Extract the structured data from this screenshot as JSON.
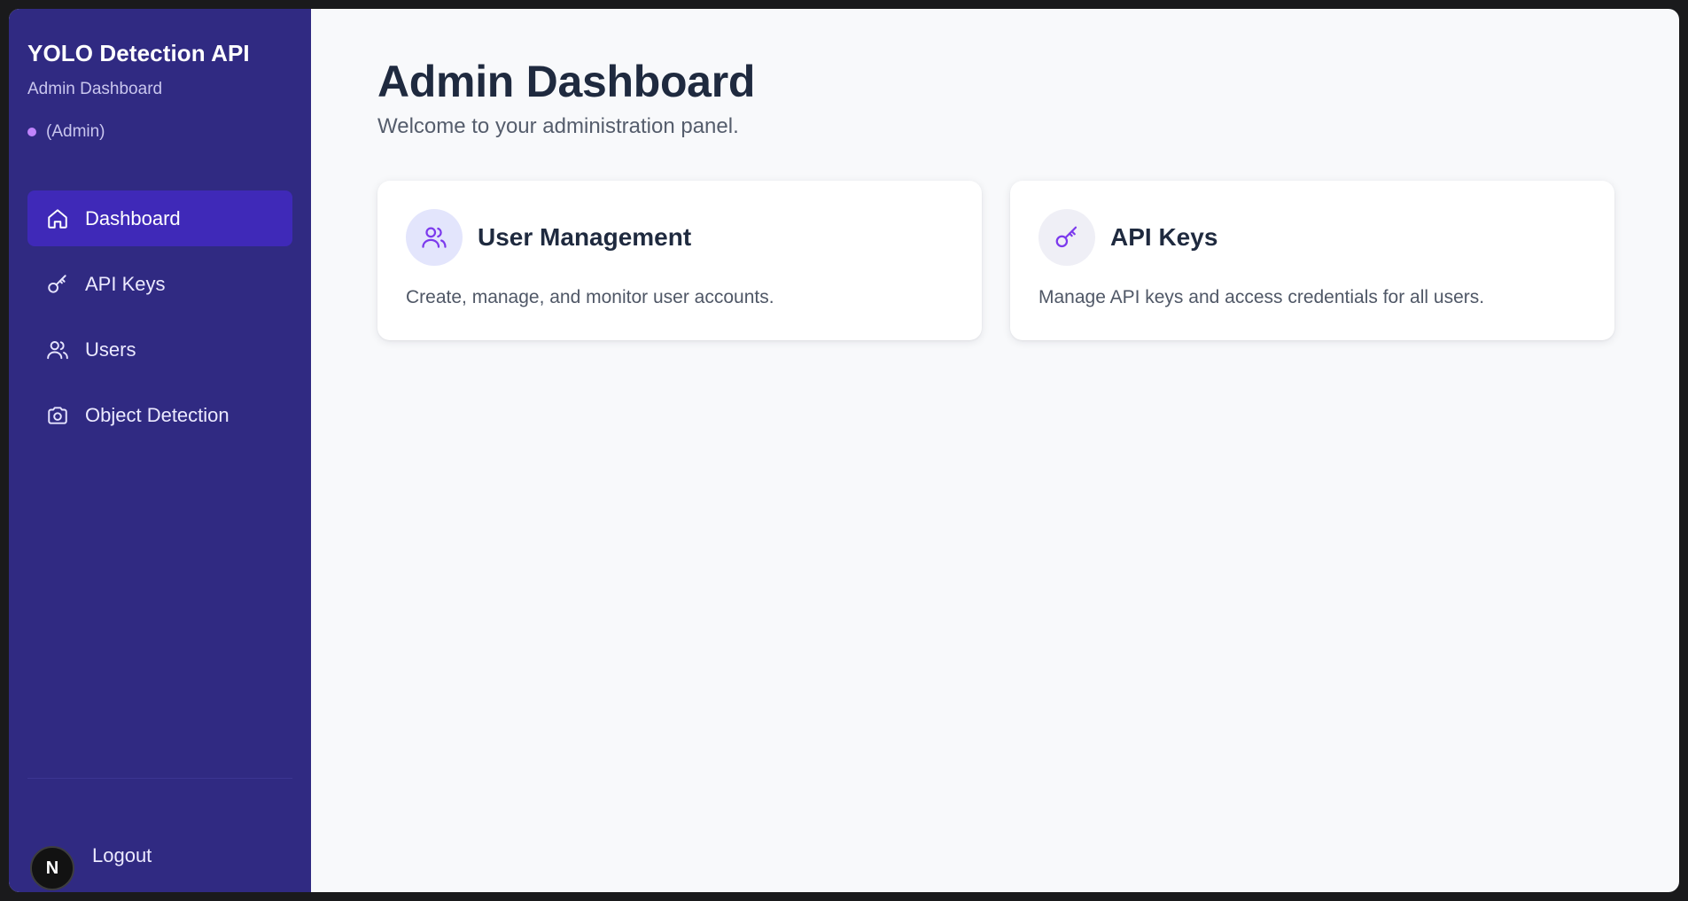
{
  "sidebar": {
    "brand_title": "YOLO Detection API",
    "brand_subtitle": "Admin Dashboard",
    "role_label": "(Admin)",
    "items": [
      {
        "label": "Dashboard",
        "icon": "home-icon",
        "active": true
      },
      {
        "label": "API Keys",
        "icon": "key-icon",
        "active": false
      },
      {
        "label": "Users",
        "icon": "users-icon",
        "active": false
      },
      {
        "label": "Object Detection",
        "icon": "camera-icon",
        "active": false
      }
    ],
    "logout_label": "Logout",
    "avatar_letter": "N"
  },
  "main": {
    "title": "Admin Dashboard",
    "subtitle": "Welcome to your administration panel.",
    "cards": [
      {
        "title": "User Management",
        "description": "Create, manage, and monitor user accounts.",
        "icon": "users-icon"
      },
      {
        "title": "API Keys",
        "description": "Manage API keys and access credentials for all users.",
        "icon": "key-icon"
      }
    ]
  },
  "colors": {
    "sidebar_bg": "#302a82",
    "active_item_bg": "#3f29b8",
    "accent_purple": "#7c3aed",
    "role_dot": "#c084fc",
    "main_bg": "#f8f9fb",
    "heading_text": "#1f2a3f"
  }
}
